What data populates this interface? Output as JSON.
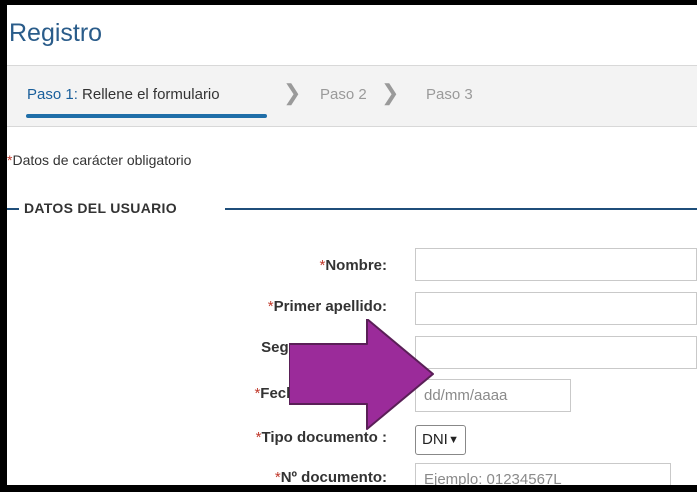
{
  "page": {
    "title": "Registro"
  },
  "steps": {
    "step1_num": "Paso 1:",
    "step1_text": "Rellene el formulario",
    "step2": "Paso 2",
    "step3": "Paso 3",
    "chevron": "❯"
  },
  "form": {
    "required_star": "*",
    "required_note": "Datos de carácter obligatorio",
    "section_legend": "DATOS DEL USUARIO",
    "fields": {
      "nombre_label": "Nombre:",
      "apellido1_label": "Primer apellido:",
      "apellido2_label": "Segun",
      "fecha_label": "Fecha nacimiento",
      "fecha_placeholder": "dd/mm/aaaa",
      "tipo_label": "Tipo documento :",
      "tipo_value": "DNI",
      "num_label": "Nº documento:",
      "num_placeholder": "Ejemplo: 01234567L"
    }
  },
  "overlay": {
    "arrow_color": "#9b2b9a",
    "arrow_border": "#5a1f57"
  }
}
